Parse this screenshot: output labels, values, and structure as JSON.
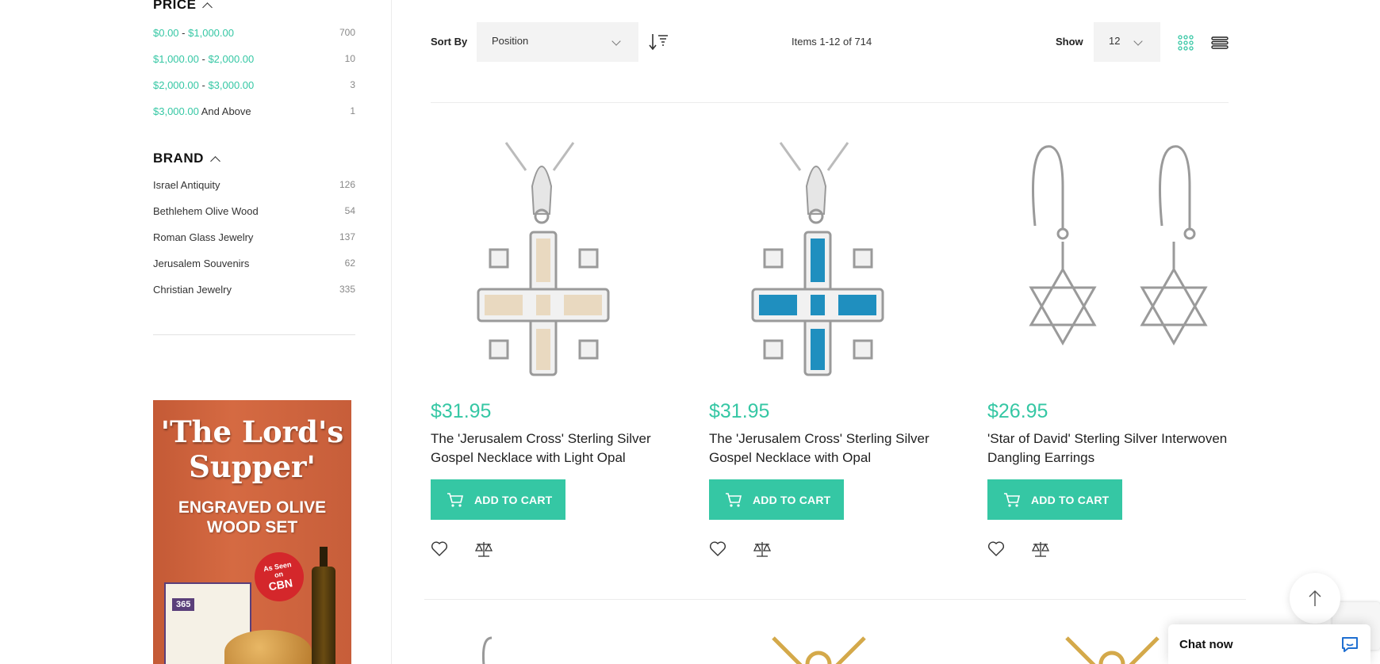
{
  "filters": {
    "price": {
      "title": "PRICE",
      "items": [
        {
          "from": "$0.00",
          "sep": "-",
          "to": "$1,000.00",
          "count": "700"
        },
        {
          "from": "$1,000.00",
          "sep": "-",
          "to": "$2,000.00",
          "count": "10"
        },
        {
          "from": "$2,000.00",
          "sep": "-",
          "to": "$3,000.00",
          "count": "3"
        },
        {
          "from": "$3,000.00",
          "sep": "And Above",
          "to": "",
          "count": "1"
        }
      ]
    },
    "brand": {
      "title": "BRAND",
      "items": [
        {
          "label": "Israel Antiquity",
          "count": "126"
        },
        {
          "label": "Bethlehem Olive Wood",
          "count": "54"
        },
        {
          "label": "Roman Glass Jewelry",
          "count": "137"
        },
        {
          "label": "Jerusalem Souvenirs",
          "count": "62"
        },
        {
          "label": "Christian Jewelry",
          "count": "335"
        }
      ]
    }
  },
  "ad": {
    "title": "'The Lord's Supper'",
    "subtitle": "ENGRAVED OLIVE WOOD SET",
    "badge_top": "As Seen",
    "badge_mid": "on",
    "badge_bottom": "CBN",
    "box_label": "365"
  },
  "toolbar": {
    "sort_label": "Sort By",
    "sort_value": "Position",
    "items_count": "Items 1-12 of 714",
    "show_label": "Show",
    "show_value": "12"
  },
  "products": [
    {
      "price": "$31.95",
      "name": "The 'Jerusalem Cross' Sterling Silver Gospel Necklace with Light Opal",
      "button": "ADD TO CART"
    },
    {
      "price": "$31.95",
      "name": "The 'Jerusalem Cross' Sterling Silver Gospel Necklace with Opal",
      "button": "ADD TO CART"
    },
    {
      "price": "$26.95",
      "name": "'Star of David' Sterling Silver Interwoven Dangling Earrings",
      "button": "ADD TO CART"
    }
  ],
  "chat": {
    "label": "Chat now"
  },
  "colors": {
    "accent": "#35c7a4",
    "ad_background": "#c45a36"
  }
}
